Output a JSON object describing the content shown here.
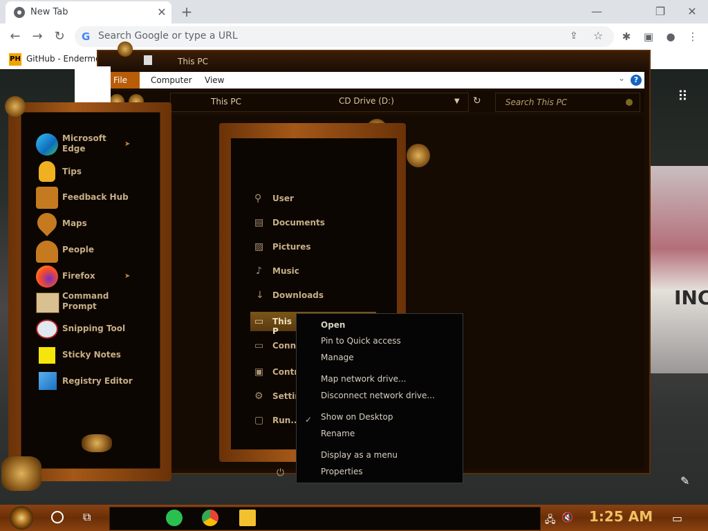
{
  "chrome": {
    "tab_title": "New Tab",
    "tab_close": "✕",
    "new_tab": "+",
    "minimize": "—",
    "restore": "❐",
    "close": "✕",
    "back": "←",
    "forward": "→",
    "reload": "↻",
    "omnibox_g": "G",
    "omnibox_placeholder": "Search Google or type a URL",
    "share": "⇪",
    "bookmark_star": "☆",
    "extensions": "✱",
    "sidepanel": "▣",
    "profile": "●",
    "menu": "⋮",
    "bookmark_icon": "PH",
    "bookmark_label": "GitHub - Endermo"
  },
  "desktop": {
    "apps_grid": "⠿",
    "awning_text": "INC",
    "edit": "✎"
  },
  "explorer": {
    "title": "This PC",
    "ribbon": {
      "file": "File",
      "computer": "Computer",
      "view": "View",
      "chevron": "⌄",
      "help": "?"
    },
    "address": "This PC",
    "address_chevron": "▼",
    "refresh": "↻",
    "search_placeholder": "Search This PC",
    "cd_drive": "CD Drive (D:)"
  },
  "start_menu": {
    "apps": [
      {
        "label": "Microsoft\nEdge",
        "l1": "Microsoft",
        "l2": "Edge",
        "has_arrow": true
      },
      {
        "label": "Tips",
        "l1": "Tips"
      },
      {
        "label": "Feedback Hub",
        "l1": "Feedback Hub"
      },
      {
        "label": "Maps",
        "l1": "Maps"
      },
      {
        "label": "People",
        "l1": "People"
      },
      {
        "label": "Firefox",
        "l1": "Firefox",
        "has_arrow": true
      },
      {
        "label": "Command\nPrompt",
        "l1": "Command",
        "l2": "Prompt"
      },
      {
        "label": "Snipping Tool",
        "l1": "Snipping Tool"
      },
      {
        "label": "Sticky Notes",
        "l1": "Sticky Notes"
      },
      {
        "label": "Registry Editor",
        "l1": "Registry Editor"
      }
    ],
    "arrow": "➤",
    "right_column": {
      "user": "User",
      "documents": "Documents",
      "pictures": "Pictures",
      "music": "Music",
      "downloads": "Downloads",
      "this_pc": "This P",
      "connect": "Conne",
      "control": "Contro",
      "settings": "Settin",
      "run": "Run..."
    }
  },
  "context_menu": {
    "open": "Open",
    "pin": "Pin to Quick access",
    "manage": "Manage",
    "map_drive": "Map network drive...",
    "disconnect": "Disconnect network drive...",
    "show_desktop": "Show on Desktop",
    "check": "✓",
    "rename": "Rename",
    "display_menu": "Display as a menu",
    "properties": "Properties"
  },
  "taskbar": {
    "task_view": "⧉",
    "clock": "1:25 AM",
    "network": "🖧",
    "volume": "🔇",
    "notifications": "▭"
  }
}
